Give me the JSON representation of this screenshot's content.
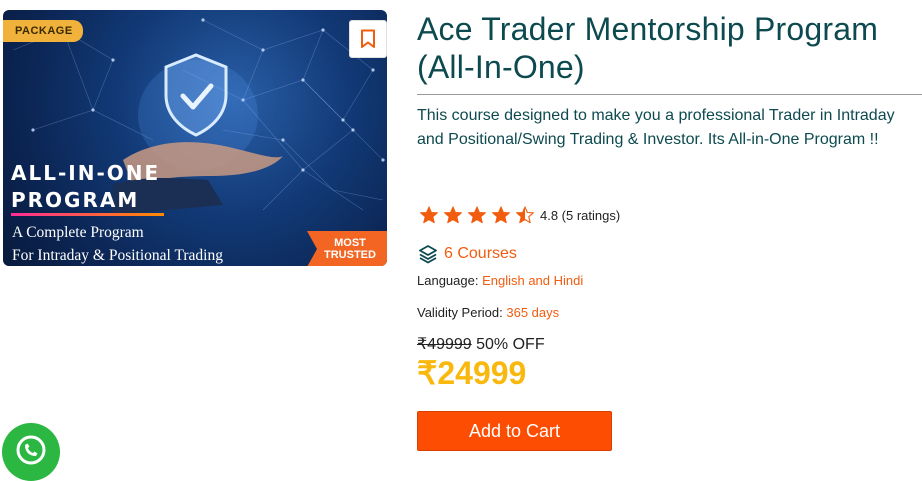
{
  "course_card": {
    "badge": "PACKAGE",
    "banner_heading_line1": "ALL-IN-ONE",
    "banner_heading_line2": "PROGRAM",
    "banner_sub_line1": "A Complete Program",
    "banner_sub_line2": "For Intraday & Positional Trading",
    "trusted_line1": "MOST",
    "trusted_line2": "TRUSTED"
  },
  "course": {
    "title": "Ace Trader Mentorship Program (All-In-One)",
    "description": "This course designed to make you a professional Trader in Intraday and Positional/Swing Trading & Investor. Its All-in-One Program !!",
    "rating": {
      "value": 4.8,
      "text": "4.8 (5 ratings)",
      "max_stars": 5
    },
    "courses_label": "6 Courses",
    "language_label": "Language:",
    "language_value": "English and Hindi",
    "validity_label": "Validity Period:",
    "validity_value": "365 days",
    "original_price": "₹49999",
    "discount": "50% OFF",
    "price": "₹24999",
    "add_to_cart": "Add to Cart"
  },
  "colors": {
    "accent": "#fc4d02",
    "title": "#0d4a4f",
    "price": "#f9b80e",
    "star": "#f25c0f",
    "whatsapp": "#2bb741"
  },
  "icons": {
    "bookmark": "bookmark-icon",
    "layers": "layers-icon",
    "whatsapp": "whatsapp-icon",
    "star": "star-icon"
  }
}
